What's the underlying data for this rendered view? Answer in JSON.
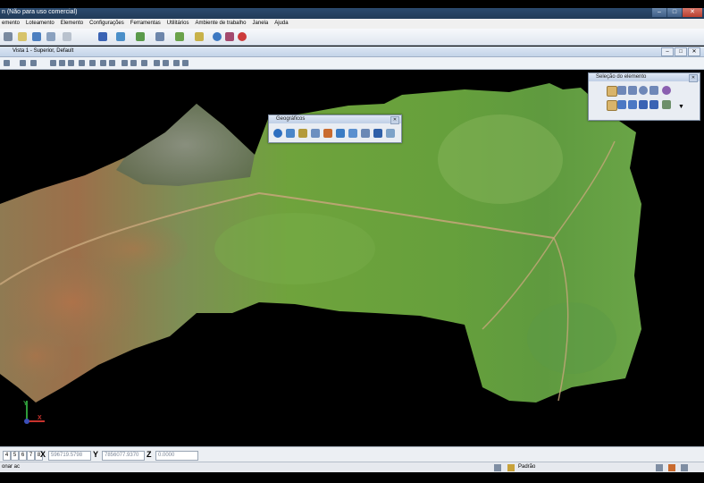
{
  "window": {
    "title": "n (Não para uso comercial)"
  },
  "menu": [
    "emento",
    "Loteamento",
    "Elemento",
    "Configurações",
    "Ferramentas",
    "Utilitários",
    "Ambiente de trabalho",
    "Janela",
    "Ajuda"
  ],
  "view": {
    "title": "Vista 1 - Superior, Default"
  },
  "palettes": {
    "geograficos": {
      "title": "Geográficos"
    },
    "selecao": {
      "title": "Seleção do elemento"
    }
  },
  "axes": {
    "y": "Y",
    "x": "X"
  },
  "status": {
    "view_buttons": [
      "4",
      "5",
      "6",
      "7",
      "8"
    ],
    "x_label": "X",
    "x_value": "596719.5798",
    "y_label": "Y",
    "y_value": "7856077.9370",
    "z_label": "Z",
    "z_value": "0.0000",
    "prompt": "onar ac",
    "level": "Padrão"
  },
  "colors": {
    "titlebar": "#223b58",
    "terrain_green": "#6fa33c",
    "terrain_red": "#b5744a",
    "background": "#000000"
  }
}
